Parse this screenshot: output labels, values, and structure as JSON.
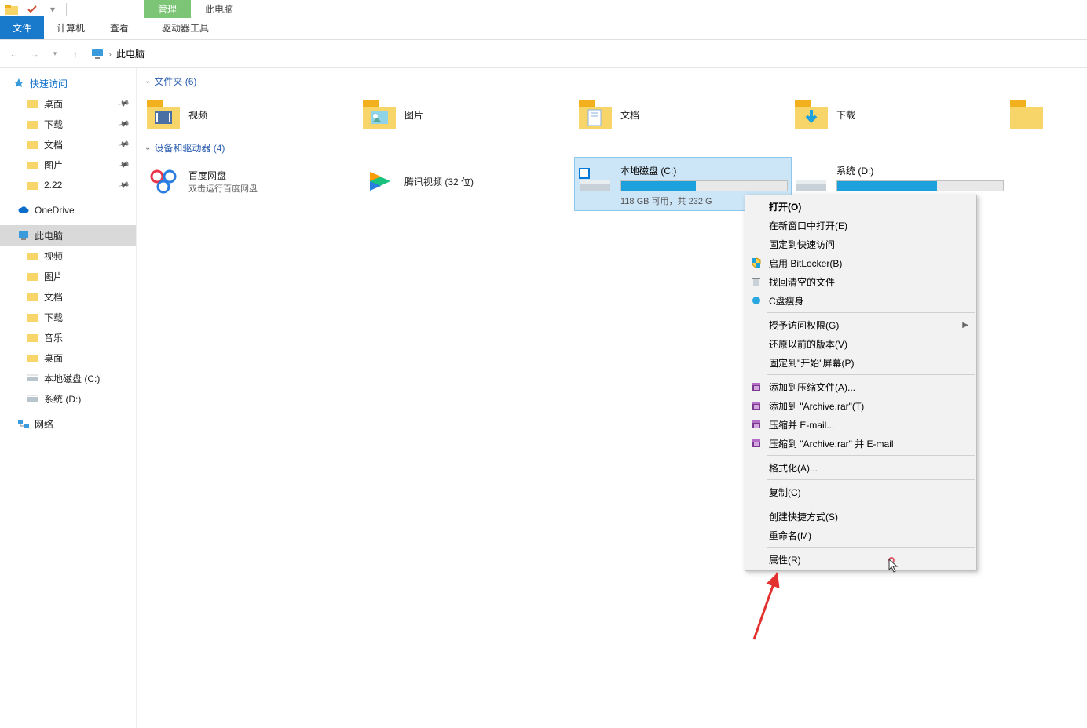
{
  "titlebar": {
    "manage_tab": "管理",
    "location_tab": "此电脑"
  },
  "ribbon": {
    "file": "文件",
    "computer": "计算机",
    "view": "查看",
    "drive_tools": "驱动器工具"
  },
  "breadcrumb": {
    "location": "此电脑"
  },
  "sidebar": {
    "quick_access": "快速访问",
    "quick_items": [
      {
        "label": "桌面"
      },
      {
        "label": "下载"
      },
      {
        "label": "文档"
      },
      {
        "label": "图片"
      },
      {
        "label": "2.22"
      }
    ],
    "onedrive": "OneDrive",
    "this_pc": "此电脑",
    "pc_items": [
      {
        "label": "视频"
      },
      {
        "label": "图片"
      },
      {
        "label": "文档"
      },
      {
        "label": "下载"
      },
      {
        "label": "音乐"
      },
      {
        "label": "桌面"
      },
      {
        "label": "本地磁盘 (C:)"
      },
      {
        "label": "系统 (D:)"
      }
    ],
    "network": "网络"
  },
  "main": {
    "folders_header": "文件夹 (6)",
    "folders": [
      {
        "name": "视频"
      },
      {
        "name": "图片"
      },
      {
        "name": "文档"
      },
      {
        "name": "下载"
      }
    ],
    "devices_header": "设备和驱动器 (4)",
    "apps": [
      {
        "name": "百度网盘",
        "sub": "双击运行百度网盘"
      },
      {
        "name": "腾讯视频 (32 位)",
        "sub": ""
      }
    ],
    "drives": [
      {
        "name": "本地磁盘 (C:)",
        "sub": "118 GB 可用，共 232 G",
        "fill": 45
      },
      {
        "name": "系统 (D:)",
        "sub": "",
        "fill": 60
      }
    ]
  },
  "context_menu": {
    "items": [
      {
        "label": "打开(O)",
        "bold": true
      },
      {
        "label": "在新窗口中打开(E)"
      },
      {
        "label": "固定到快速访问"
      },
      {
        "label": "启用 BitLocker(B)",
        "icon": "shield"
      },
      {
        "label": "找回清空的文件",
        "icon": "recycle"
      },
      {
        "label": "C盘瘦身",
        "icon": "slim"
      },
      {
        "sep": true
      },
      {
        "label": "授予访问权限(G)",
        "more": true
      },
      {
        "label": "还原以前的版本(V)"
      },
      {
        "label": "固定到\"开始\"屏幕(P)"
      },
      {
        "sep": true
      },
      {
        "label": "添加到压缩文件(A)...",
        "icon": "rar"
      },
      {
        "label": "添加到 \"Archive.rar\"(T)",
        "icon": "rar"
      },
      {
        "label": "压缩并 E-mail...",
        "icon": "rar"
      },
      {
        "label": "压缩到 \"Archive.rar\" 并 E-mail",
        "icon": "rar"
      },
      {
        "sep": true
      },
      {
        "label": "格式化(A)..."
      },
      {
        "sep": true
      },
      {
        "label": "复制(C)"
      },
      {
        "sep": true
      },
      {
        "label": "创建快捷方式(S)"
      },
      {
        "label": "重命名(M)"
      },
      {
        "sep": true
      },
      {
        "label": "属性(R)"
      }
    ]
  }
}
